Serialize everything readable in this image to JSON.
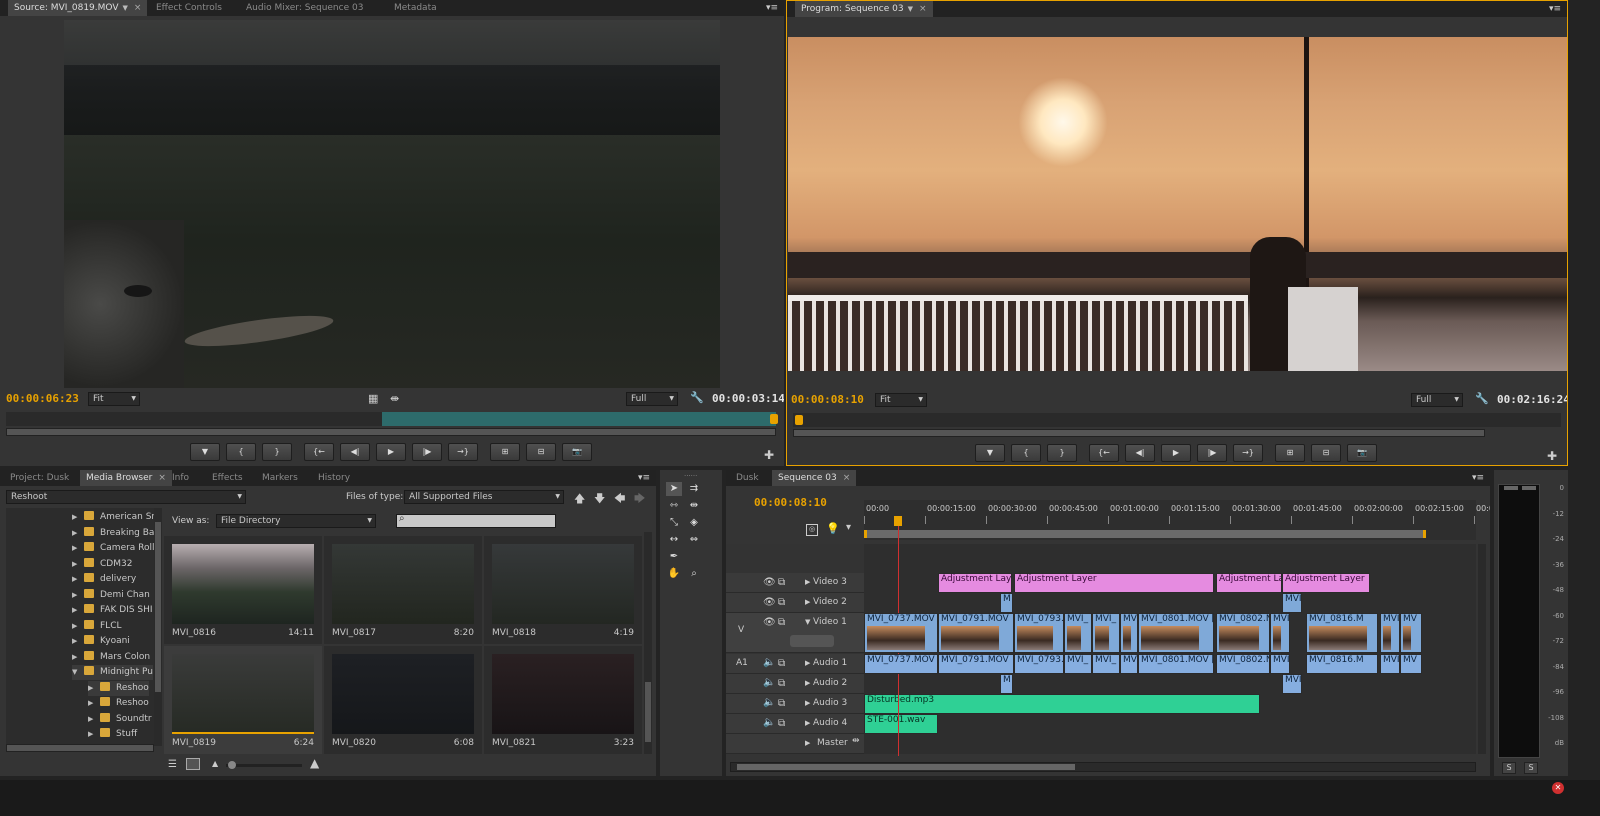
{
  "source_monitor": {
    "tabs": [
      {
        "label": "Source: MVI_0819.MOV"
      },
      {
        "label": "Effect Controls"
      },
      {
        "label": "Audio Mixer: Sequence 03"
      },
      {
        "label": "Metadata"
      }
    ],
    "timecode_left": "00:00:06:23",
    "fit": "Fit",
    "quality": "Full",
    "timecode_right": "00:00:03:14"
  },
  "program_monitor": {
    "tab": "Program: Sequence 03",
    "timecode_left": "00:00:08:10",
    "fit": "Fit",
    "quality": "Full",
    "timecode_right": "00:02:16:24"
  },
  "project_panel": {
    "tabs": [
      {
        "label": "Project: Dusk"
      },
      {
        "label": "Media Browser"
      },
      {
        "label": "Info"
      },
      {
        "label": "Effects"
      },
      {
        "label": "Markers"
      },
      {
        "label": "History"
      }
    ],
    "location": "Reshoot",
    "files_of_type_label": "Files of type:",
    "files_of_type": "All Supported Files",
    "view_as_label": "View as:",
    "view_as": "File Directory",
    "tree": [
      {
        "label": "American Sn",
        "level": 0
      },
      {
        "label": "Breaking Ba",
        "level": 0
      },
      {
        "label": "Camera Roll",
        "level": 0
      },
      {
        "label": "CDM32",
        "level": 0
      },
      {
        "label": "delivery",
        "level": 0
      },
      {
        "label": "Demi Chan",
        "level": 0
      },
      {
        "label": "FAK DIS SHI",
        "level": 0
      },
      {
        "label": "FLCL",
        "level": 0
      },
      {
        "label": "Kyoani",
        "level": 0
      },
      {
        "label": "Mars Colon",
        "level": 0
      },
      {
        "label": "Midnight Pu",
        "level": 0
      },
      {
        "label": "Reshoo",
        "level": 1
      },
      {
        "label": "Reshoo",
        "level": 1
      },
      {
        "label": "Soundtr",
        "level": 1
      },
      {
        "label": "Stuff",
        "level": 1
      }
    ],
    "thumbs": [
      {
        "name": "MVI_0816",
        "dur": "14:11"
      },
      {
        "name": "MVI_0817",
        "dur": "8:20"
      },
      {
        "name": "MVI_0818",
        "dur": "4:19"
      },
      {
        "name": "MVI_0819",
        "dur": "6:24"
      },
      {
        "name": "MVI_0820",
        "dur": "6:08"
      },
      {
        "name": "MVI_0821",
        "dur": "3:23"
      }
    ]
  },
  "timeline": {
    "tabs": [
      {
        "label": "Dusk"
      },
      {
        "label": "Sequence 03"
      }
    ],
    "timecode": "00:00:08:10",
    "ruler": [
      "00:00",
      "00:00:15:00",
      "00:00:30:00",
      "00:00:45:00",
      "00:01:00:00",
      "00:01:15:00",
      "00:01:30:00",
      "00:01:45:00",
      "00:02:00:00",
      "00:02:15:00",
      "00:02"
    ],
    "tracks": {
      "v3": "Video 3",
      "v2": "Video 2",
      "v1": "Video 1",
      "a1": "Audio 1",
      "a2": "Audio 2",
      "a3": "Audio 3",
      "a4": "Audio 4",
      "master": "Master",
      "v_target": "V",
      "a_target": "A1"
    },
    "clips": {
      "adj1": "Adjustment Laye",
      "adj2": "Adjustment Layer",
      "adj3": "Adjustment La",
      "adj4": "Adjustment Layer",
      "v2a": "M",
      "v2b": "MVI",
      "v1": [
        "MVI_0737.MOV [V",
        "MVI_0791.MOV",
        "MVI_0793.M",
        "MVI_",
        "MVI_",
        "MV",
        "MVI_0801.MOV [V",
        "MVI_0802.N",
        "MVI",
        "MVI_0816.M",
        "MVI_",
        "MV"
      ],
      "a1": [
        "MVI_0737.MOV [A",
        "MVI_0791.MOV",
        "MVI_0793.M",
        "MVI_",
        "MVI_",
        "MV",
        "MVI_0801.MOV [A",
        "MVI_0802.N",
        "MVI",
        "MVI_0816.M",
        "MVI_",
        "MV"
      ],
      "a2a": "M",
      "a2b": "MVI",
      "a3": "Disturbed.mp3",
      "a4": "STE-001.wav"
    }
  },
  "audio_meter": {
    "scale": [
      "0",
      "-12",
      "-24",
      "-36",
      "-48",
      "-60",
      "-72",
      "-84",
      "-96",
      "-108",
      "dB"
    ],
    "solo_left": "S",
    "solo_right": "S"
  }
}
